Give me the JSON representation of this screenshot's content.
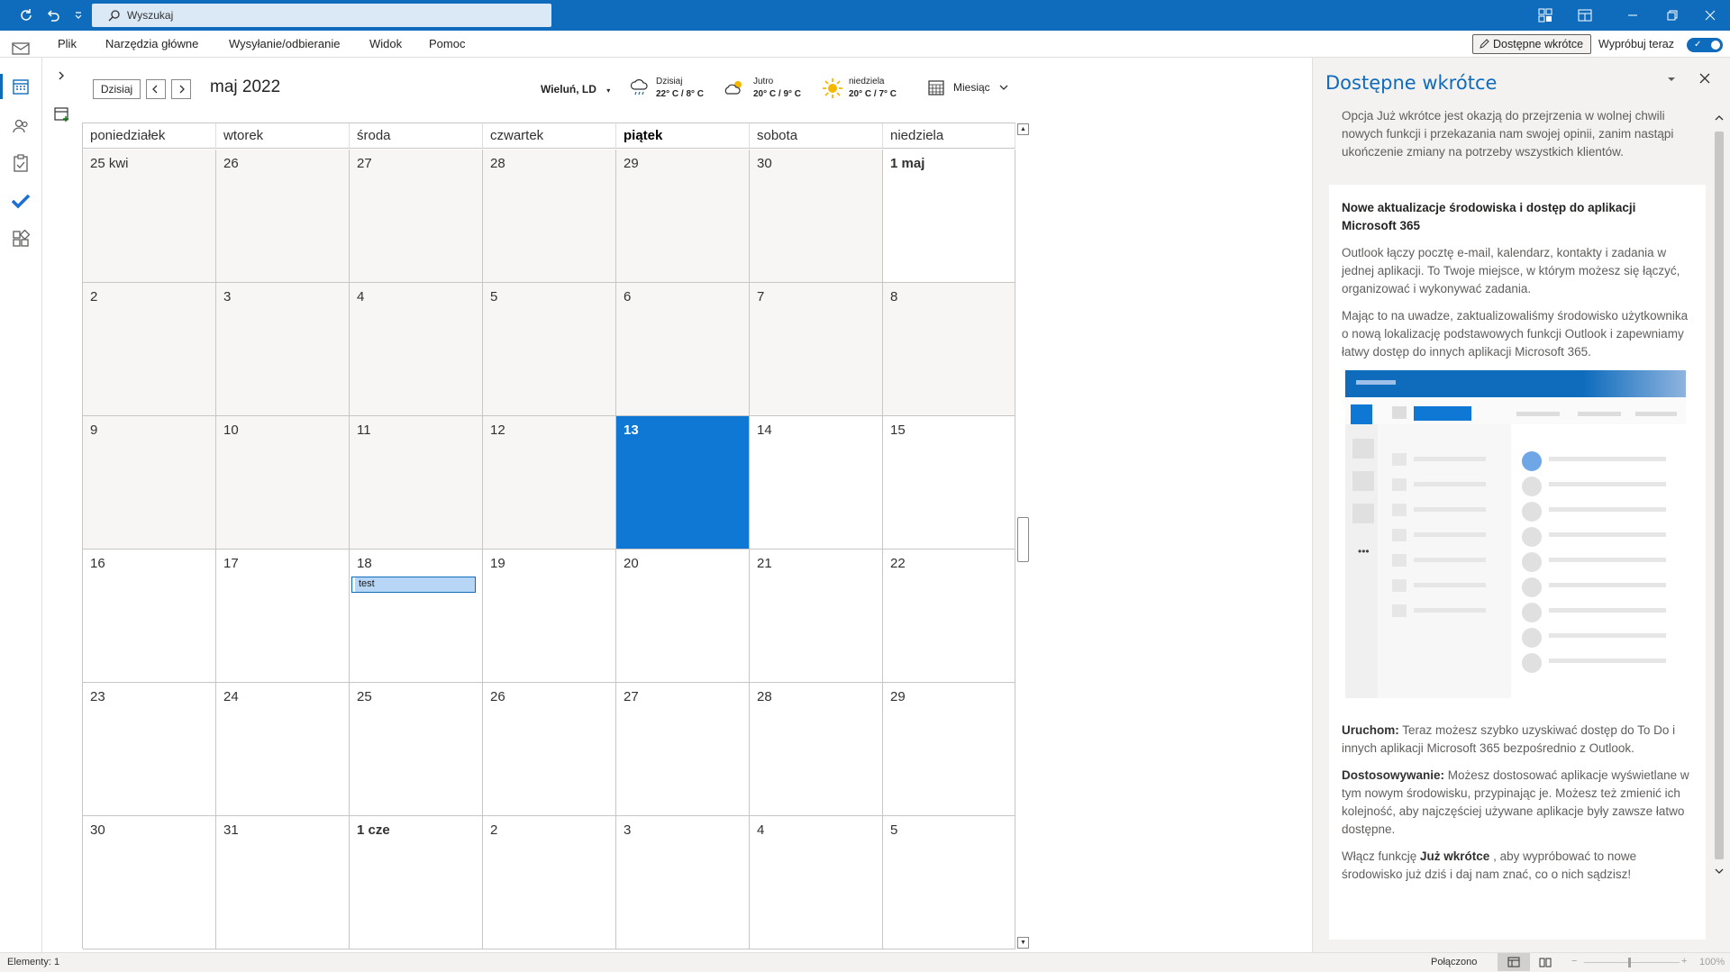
{
  "titlebar": {
    "search_placeholder": "Wyszukaj",
    "accent": "#0f6cbd"
  },
  "menu": {
    "items": [
      "Plik",
      "Narzędzia główne",
      "Wysyłanie/odbieranie",
      "Widok",
      "Pomoc"
    ],
    "coming_soon_button": "Dostępne wkrótce",
    "try_now": "Wypróbuj teraz"
  },
  "rail": {
    "icons": [
      "mail-icon",
      "calendar-icon",
      "people-icon",
      "tasks-icon",
      "todo-icon",
      "apps-icon"
    ]
  },
  "toolbar": {
    "today": "Dzisiaj",
    "month_title": "maj 2022",
    "location": "Wieluń, LD",
    "weather": [
      {
        "label": "Dzisiaj",
        "temp": "22° C / 8° C",
        "icon": "rain-icon"
      },
      {
        "label": "Jutro",
        "temp": "20° C / 9° C",
        "icon": "partly-cloudy-icon"
      },
      {
        "label": "niedziela",
        "temp": "20° C / 7° C",
        "icon": "sun-icon"
      }
    ],
    "view": "Miesiąc"
  },
  "calendar": {
    "weekdays": [
      "poniedziałek",
      "wtorek",
      "środa",
      "czwartek",
      "piątek",
      "sobota",
      "niedziela"
    ],
    "today_column": 4,
    "weeks": [
      [
        "25 kwi",
        "26",
        "27",
        "28",
        "29",
        "30",
        "1 maj"
      ],
      [
        "2",
        "3",
        "4",
        "5",
        "6",
        "7",
        "8"
      ],
      [
        "9",
        "10",
        "11",
        "12",
        "13",
        "14",
        "15"
      ],
      [
        "16",
        "17",
        "18",
        "19",
        "20",
        "21",
        "22"
      ],
      [
        "23",
        "24",
        "25",
        "26",
        "27",
        "28",
        "29"
      ],
      [
        "30",
        "31",
        "1 cze",
        "2",
        "3",
        "4",
        "5"
      ]
    ],
    "event": {
      "title": "test",
      "week": 3,
      "day": 2
    }
  },
  "pane": {
    "title": "Dostępne wkrótce",
    "intro": "Opcja Już wkrótce jest okazją do przejrzenia w wolnej chwili nowych funkcji i przekazania nam swojej opinii, zanim nastąpi ukończenie zmiany na potrzeby wszystkich klientów.",
    "heading": "Nowe aktualizacje środowiska i dostęp do aplikacji Microsoft 365",
    "p1": "Outlook łączy pocztę e-mail, kalendarz, kontakty i zadania w jednej aplikacji. To Twoje miejsce, w którym możesz się łączyć, organizować i wykonywać zadania.",
    "p2": "Mając to na uwadze, zaktualizowaliśmy środowisko użytkownika o nową lokalizację podstawowych funkcji Outlook i zapewniamy łatwy dostęp do innych aplikacji Microsoft 365.",
    "p3_bold": "Uruchom:",
    "p3": " Teraz możesz szybko uzyskiwać dostęp do To Do i innych aplikacji Microsoft 365 bezpośrednio z Outlook.",
    "p4_bold": "Dostosowywanie:",
    "p4": " Możesz dostosować aplikacje wyświetlane w tym nowym środowisku, przypinając je. Możesz też zmienić ich kolejność, aby najczęściej używane aplikacje były zawsze łatwo dostępne.",
    "p5_pre": "Włącz funkcję ",
    "p5_bold": "Już wkrótce",
    "p5_post": " , aby wypróbować to nowe środowisko już dziś i daj nam znać, co o nich sądzisz!"
  },
  "status": {
    "items": "Elementy: 1",
    "connection": "Połączono",
    "zoom": "100%"
  }
}
